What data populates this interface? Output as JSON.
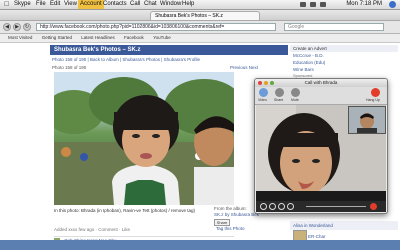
{
  "menubar": {
    "app": "Skype",
    "items": [
      "File",
      "Edit",
      "View",
      "Account",
      "Contacts",
      "Call",
      "Chat",
      "Window",
      "Help"
    ],
    "highlighted": "Account",
    "clock": "Mon 7:18 PM"
  },
  "browser": {
    "tab_title": "Shubasra Bek's Photos – SK.z",
    "url": "http://www.facebook.com/photo.php?pid=1102806&id=103806100&comments&ref=",
    "search_placeholder": "Google",
    "bookmarks": [
      "Most Visited",
      "Getting Started",
      "Latest Headlines",
      "Facebook",
      "YouTube"
    ]
  },
  "facebook": {
    "header": "Shubasra Bek's Photos – SK.z",
    "breadcrumb": "Photo 158 of 190 | Back to Album | Shubasra's Photos | Shubasra's Profile",
    "photo_nav": "Photo 158 of 190",
    "prev_next": "Previous  Next",
    "caption": "In this photo: Bhrada (in Iphoban), Ravin-ve Tett (photos) / remove tag)",
    "from_album_label": "From the album:",
    "album_name": "SK.z by Shubasra Bek",
    "share_label": "Share",
    "tag_photo": "Tag this Photo",
    "comment_meta": "Added xxxx few ago · Comment · Like",
    "comment_author": "Goh Ching Kong Nee Chu",
    "sidebar": {
      "header": "Create an Advert",
      "items": [
        "McCcrue - B.D.",
        "Education (Edu)",
        "Wine Bars",
        ""
      ],
      "sub": "Sponsored"
    },
    "profile_card_label": "Alisa in Wonderland",
    "profile_card_name": "ER-Char"
  },
  "skype": {
    "window_title": "Call with Bhrada",
    "toolbar_labels": [
      "Video",
      "Share",
      "Mute",
      "Hold",
      "Hang Up"
    ],
    "accent": "#e23c2b"
  }
}
